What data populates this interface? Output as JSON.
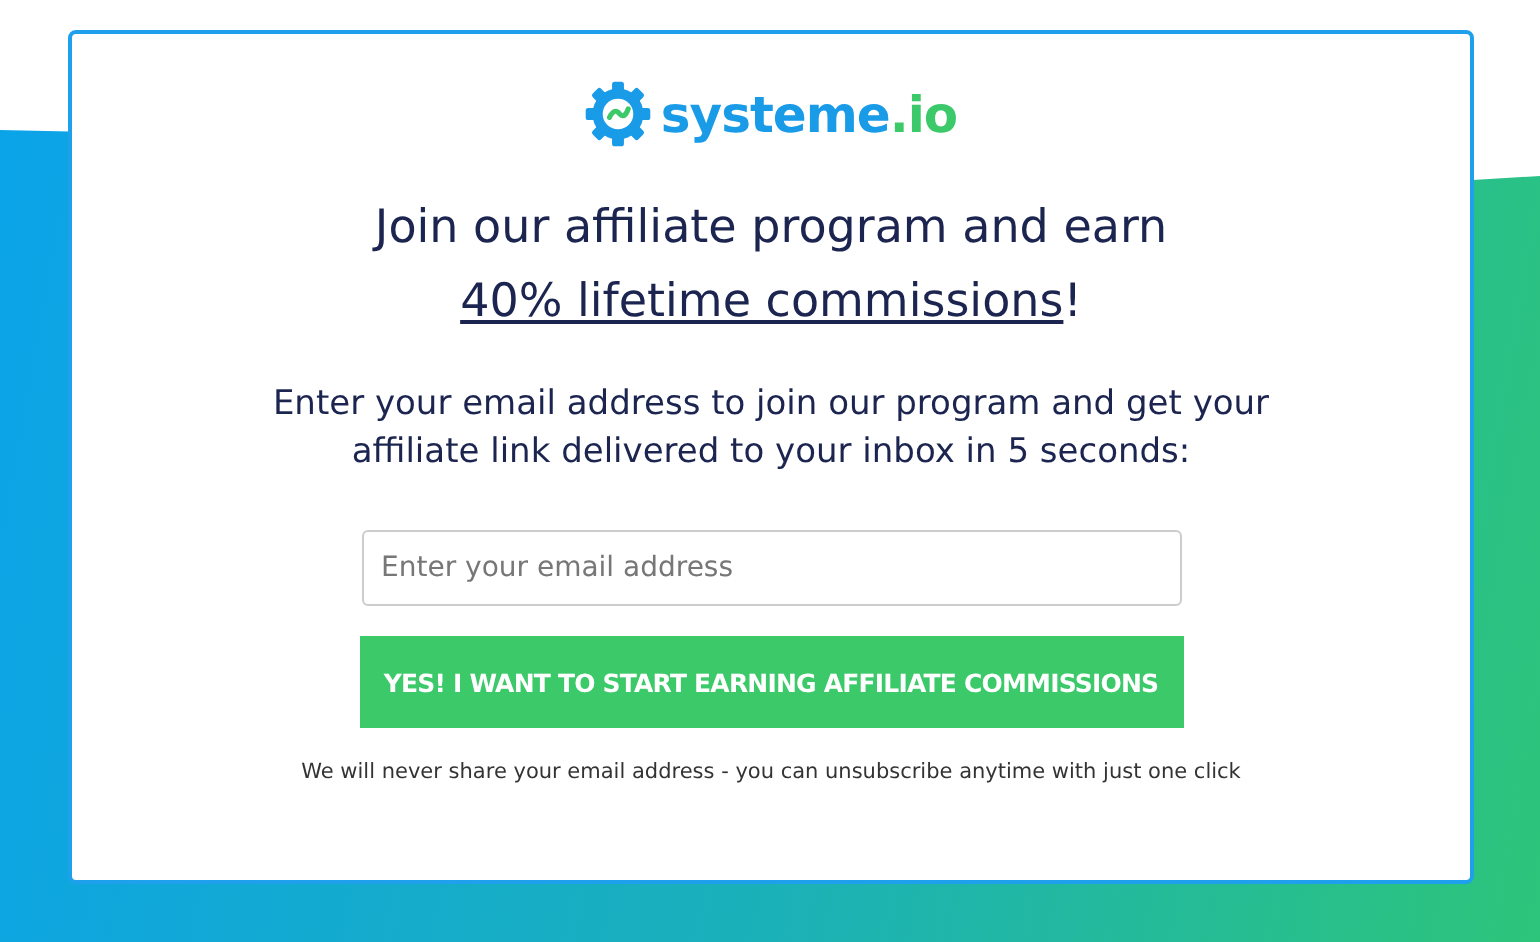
{
  "logo": {
    "main": "systeme",
    "accent": ".io"
  },
  "heading": {
    "line1": "Join our affiliate program and earn",
    "link": "40% lifetime commissions",
    "end": "!"
  },
  "intro": "Enter your email address to join our program and get your affiliate link delivered to your inbox in 5 seconds:",
  "email_field": {
    "placeholder": "Enter your email address"
  },
  "submit_button": "YES! I WANT TO START EARNING AFFILIATE COMMISSIONS",
  "privacy_note": "We will never share your email address - you can unsubscribe anytime with just one click"
}
